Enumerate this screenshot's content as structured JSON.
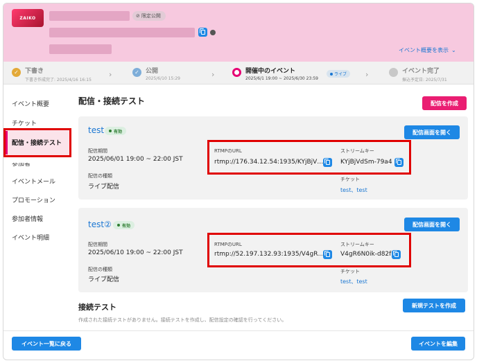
{
  "header": {
    "logo_text": "ZAIKO",
    "limited_badge": "限定公開",
    "show_summary": "イベント概要を表示",
    "chevron": "⌄"
  },
  "stepper": {
    "steps": [
      {
        "title": "下書き",
        "sub": "下書き作成完了: 2025/4/16 16:15"
      },
      {
        "title": "公開",
        "sub": "2025/6/10 15:29"
      },
      {
        "title": "開催中のイベント",
        "sub": "2025/6/1 19:00 ~ 2025/6/30 23:59"
      },
      {
        "title": "イベント完了",
        "sub": "振込予定日: 2025/7/31"
      }
    ],
    "live_badge": "ライブ"
  },
  "sidebar": {
    "items": [
      {
        "label": "イベント概要"
      },
      {
        "label": "チケット"
      },
      {
        "label": "配信・接続テスト"
      },
      {
        "label": "参加者"
      },
      {
        "label": "イベントメール"
      },
      {
        "label": "プロモーション"
      },
      {
        "label": "参加者情報"
      },
      {
        "label": "イベント明細"
      }
    ]
  },
  "main": {
    "title": "配信・接続テスト",
    "create_stream_button": "配信を作成",
    "streams": [
      {
        "name": "test",
        "status": "有効",
        "open_button": "配信画面を開く",
        "period_label": "配信期間",
        "period": "2025/06/01 19:00 ~ 22:00 JST",
        "type_label": "配信の種類",
        "type": "ライブ配信",
        "rtmp_label": "RTMPのURL",
        "rtmp_url": "rtmp://176.34.12.54:1935/KYjBjV…",
        "key_label": "ストリームキー",
        "stream_key": "KYjBjVdSm-79a4",
        "ticket_label": "チケット",
        "tickets": "test、test"
      },
      {
        "name": "test②",
        "status": "有効",
        "open_button": "配信画面を開く",
        "period_label": "配信期間",
        "period": "2025/06/10 19:00 ~ 22:00 JST",
        "type_label": "配信の種類",
        "type": "ライブ配信",
        "rtmp_label": "RTMPのURL",
        "rtmp_url": "rtmp://52.197.132.93:1935/V4gR…",
        "key_label": "ストリームキー",
        "stream_key": "V4gR6N0ik-d82f",
        "ticket_label": "チケット",
        "tickets": "test、test"
      }
    ],
    "connection_test": {
      "title": "接続テスト",
      "new_button": "新規テストを作成",
      "note": "作成された接続テストがありません。接続テストを作成し、配信設定の確認を行ってください。"
    }
  },
  "footer": {
    "back_button": "イベント一覧に戻る",
    "edit_button": "イベントを編集"
  },
  "colors": {
    "header_bg": "#f7c9df",
    "accent_pink": "#ea1e72",
    "accent_blue": "#1e88e5",
    "highlight_red": "#e00000"
  }
}
